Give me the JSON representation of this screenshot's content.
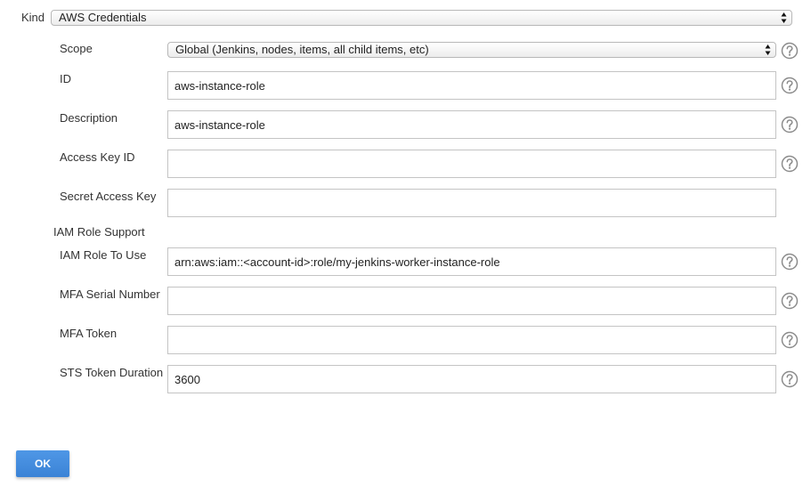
{
  "kind": {
    "label": "Kind",
    "selected": "AWS Credentials"
  },
  "fields": {
    "scope": {
      "label": "Scope",
      "selected": "Global (Jenkins, nodes, items, all child items, etc)"
    },
    "id": {
      "label": "ID",
      "value": "aws-instance-role"
    },
    "description": {
      "label": "Description",
      "value": "aws-instance-role"
    },
    "access_key_id": {
      "label": "Access Key ID",
      "value": ""
    },
    "secret_access_key": {
      "label": "Secret Access Key",
      "value": ""
    },
    "iam_section_label": "IAM Role Support",
    "iam_role_to_use": {
      "label": "IAM Role To Use",
      "value": "arn:aws:iam::<account-id>:role/my-jenkins-worker-instance-role"
    },
    "mfa_serial_number": {
      "label": "MFA Serial Number",
      "value": ""
    },
    "mfa_token": {
      "label": "MFA Token",
      "value": ""
    },
    "sts_token_duration": {
      "label": "STS Token Duration",
      "value": "3600"
    }
  },
  "ok_button": {
    "label": "OK"
  },
  "colors": {
    "ok_button": "#3b83d6",
    "help_icon": "#8c8c8c",
    "input_border": "#c4c4c4"
  },
  "icons": {
    "help": "question-circle-icon",
    "select_arrows": "up-down-arrows-icon"
  }
}
